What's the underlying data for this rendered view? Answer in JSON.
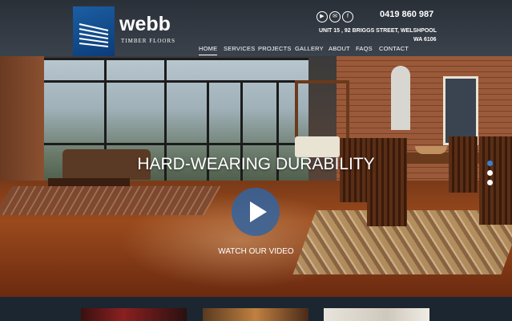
{
  "brand": {
    "name": "webb",
    "tagline": "TIMBER FLOORS"
  },
  "contact": {
    "phone": "0419 860 987",
    "address_line1": "UNIT 15 , 92 BRIGGS STREET, WELSHPOOL",
    "address_line2": "WA 6106"
  },
  "social": [
    {
      "icon": "youtube-icon",
      "glyph": "▶"
    },
    {
      "icon": "email-icon",
      "glyph": "✉"
    },
    {
      "icon": "facebook-icon",
      "glyph": "f"
    }
  ],
  "nav": [
    {
      "label": "HOME",
      "active": true
    },
    {
      "label": "SERVICES"
    },
    {
      "label": "PROJECTS"
    },
    {
      "label": "GALLERY"
    },
    {
      "label": "ABOUT"
    },
    {
      "label": "FAQS"
    },
    {
      "label": "CONTACT"
    }
  ],
  "hero": {
    "title": "HARD-WEARING DURABILITY",
    "cta": "WATCH OUR VIDEO",
    "slide_count": 3,
    "active_slide": 1
  },
  "colors": {
    "brand_blue": "#1c5ea3",
    "play_button": "#3264a0",
    "footer_bg": "#1b2631"
  }
}
